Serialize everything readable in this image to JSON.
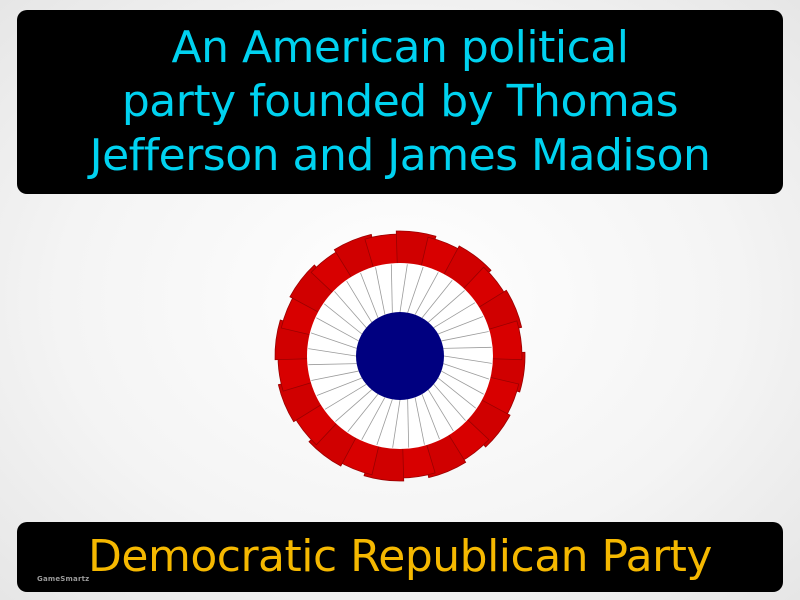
{
  "definition": {
    "text": "An American political\nparty founded by Thomas\nJefferson and James Madison"
  },
  "term": {
    "text": "Democratic Republican Party"
  },
  "brand": {
    "text": "GameSmartz"
  },
  "emblem": {
    "icon": "cockade-icon",
    "colors": {
      "outer_ring": "#d00000",
      "middle_ring": "#ffffff",
      "center": "#000080"
    }
  },
  "colors": {
    "definition_text": "#00d2f0",
    "term_text": "#f5b800",
    "box_background": "#000000"
  }
}
